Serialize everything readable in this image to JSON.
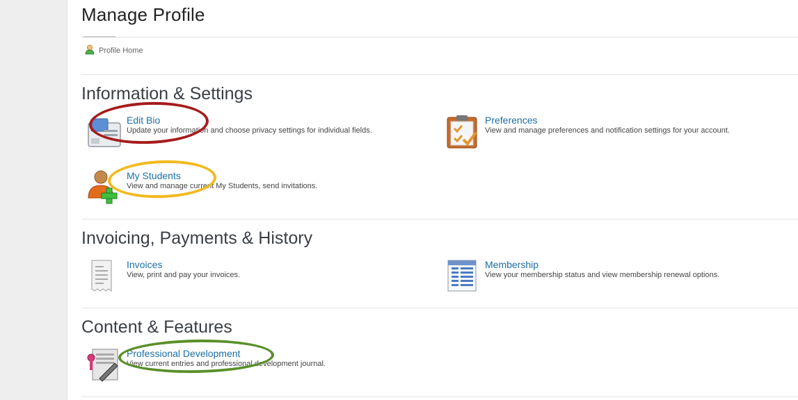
{
  "page": {
    "title": "Manage Profile"
  },
  "breadcrumb": {
    "label": "Profile Home"
  },
  "sections": [
    {
      "title": "Information & Settings",
      "items": [
        {
          "label": "Edit Bio",
          "desc": "Update your information and choose privacy settings for individual fields.",
          "icon": "edit-bio-card-icon"
        },
        {
          "label": "Preferences",
          "desc": "View and manage preferences and notification settings for your account.",
          "icon": "clipboard-check-icon"
        },
        {
          "label": "My Students",
          "desc": "View and manage current My Students, send invitations.",
          "icon": "user-add-icon"
        }
      ]
    },
    {
      "title": "Invoicing, Payments & History",
      "items": [
        {
          "label": "Invoices",
          "desc": "View, print and pay your invoices.",
          "icon": "receipt-icon"
        },
        {
          "label": "Membership",
          "desc": "View your membership status and view membership renewal options.",
          "icon": "spreadsheet-icon"
        }
      ]
    },
    {
      "title": "Content & Features",
      "items": [
        {
          "label": "Professional Development",
          "desc": "View current entries and professional development journal.",
          "icon": "certificate-pen-icon"
        }
      ]
    }
  ],
  "annotations": {
    "red": "#a61c1c",
    "yellow": "#f2b91d",
    "green": "#5a8f2a"
  },
  "colors": {
    "link": "#1c6ea4",
    "gutter": "#eeeeee",
    "divider": "#e1e1e1"
  }
}
